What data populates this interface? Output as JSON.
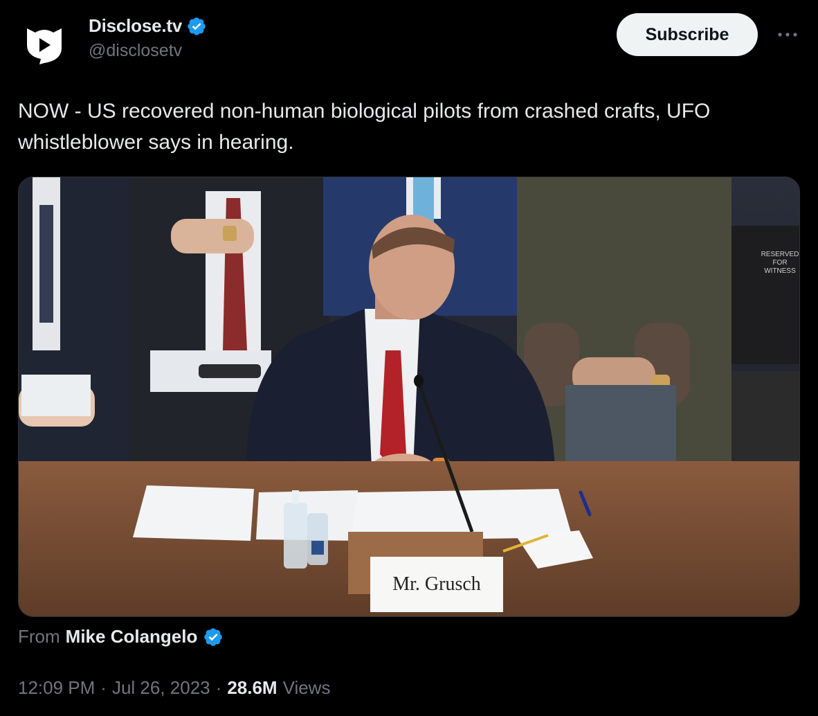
{
  "author": {
    "display_name": "Disclose.tv",
    "handle": "@disclosetv",
    "avatar_icon": "disclosetv-logo-icon",
    "verified_icon": "verified-badge-icon",
    "verified_color": "#1d9bf0"
  },
  "actions": {
    "subscribe_label": "Subscribe",
    "more_icon": "more-options-icon"
  },
  "tweet": {
    "text": "NOW - US recovered non-human biological pilots from crashed crafts, UFO whistleblower says in hearing."
  },
  "media": {
    "name_placard": "Mr. Grusch",
    "sign_text": [
      "RESERVED",
      "FOR",
      "WITNESS"
    ]
  },
  "source": {
    "prefix": "From",
    "name": "Mike Colangelo"
  },
  "meta": {
    "time": "12:09 PM",
    "separator": "·",
    "date": "Jul 26, 2023",
    "views_count": "28.6M",
    "views_label": "Views"
  }
}
